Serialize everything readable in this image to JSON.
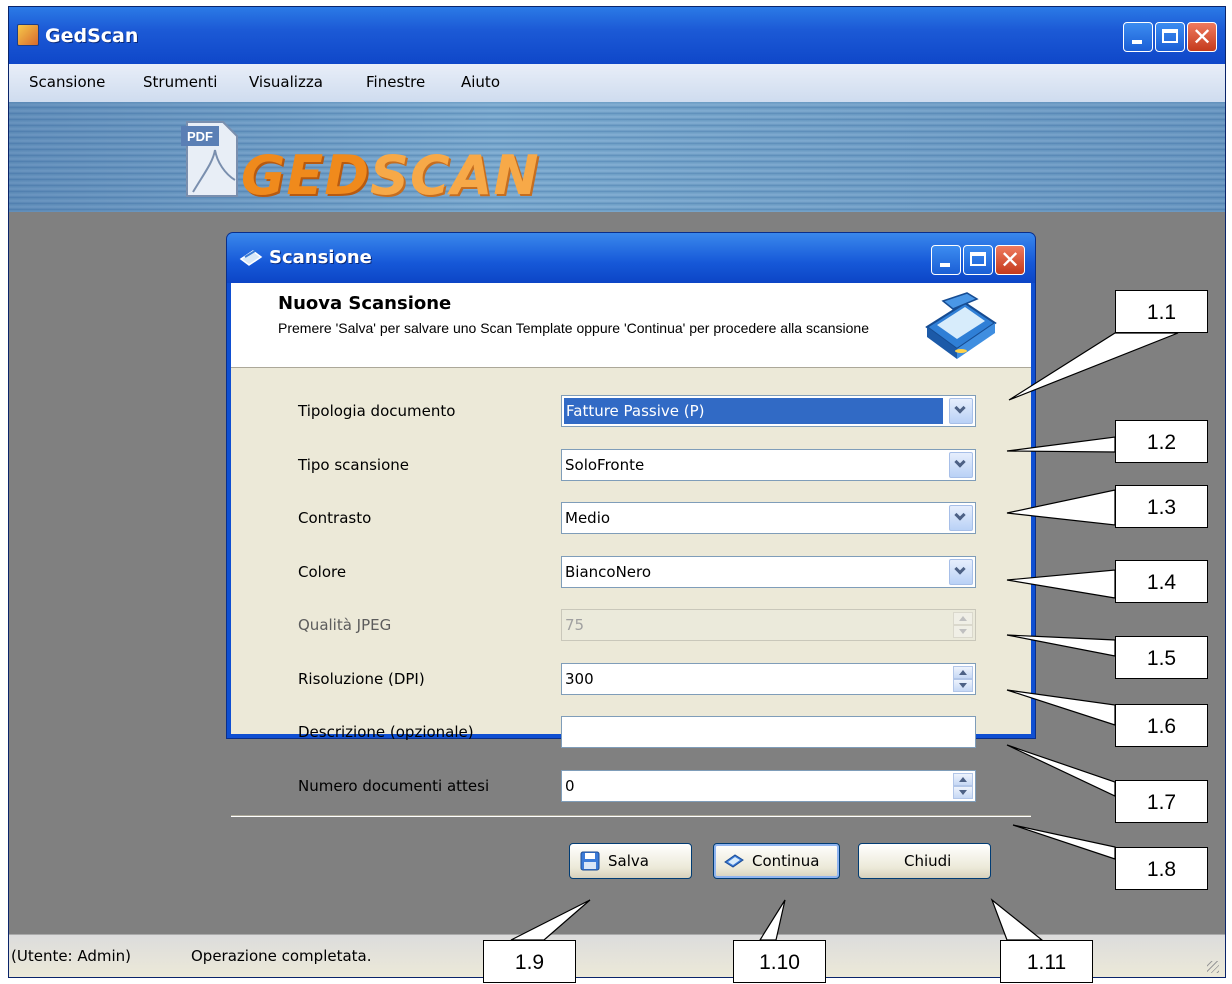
{
  "window": {
    "title": "GedScan"
  },
  "menu": [
    "Scansione",
    "Strumenti",
    "Visualizza",
    "Finestre",
    "Aiuto"
  ],
  "banner": {
    "pdf_tag": "PDF",
    "logo_part1": "GED",
    "logo_part2": "SCAN"
  },
  "dialog": {
    "title": "Scansione",
    "header_title": "Nuova Scansione",
    "header_desc": "Premere 'Salva' per salvare uno Scan Template oppure 'Continua' per procedere alla scansione",
    "fields": [
      {
        "label": "Tipologia documento",
        "value": "Fatture Passive (P)",
        "type": "dropdown",
        "selected": true
      },
      {
        "label": "Tipo scansione",
        "value": "SoloFronte",
        "type": "dropdown"
      },
      {
        "label": "Contrasto",
        "value": "Medio",
        "type": "dropdown"
      },
      {
        "label": "Colore",
        "value": "BiancoNero",
        "type": "dropdown"
      },
      {
        "label": "Qualità JPEG",
        "value": "75",
        "type": "spinner",
        "disabled": true
      },
      {
        "label": "Risoluzione (DPI)",
        "value": "300",
        "type": "spinner"
      },
      {
        "label": "Descrizione (opzionale)",
        "value": "",
        "type": "text"
      },
      {
        "label": "Numero documenti attesi",
        "value": "0",
        "type": "spinner"
      }
    ],
    "buttons": {
      "save": "Salva",
      "continue": "Continua",
      "close": "Chiudi"
    }
  },
  "status": {
    "user": "(Utente: Admin)",
    "message": "Operazione completata."
  },
  "callouts": [
    "1.1",
    "1.2",
    "1.3",
    "1.4",
    "1.5",
    "1.6",
    "1.7",
    "1.8",
    "1.9",
    "1.10",
    "1.11"
  ],
  "colors": {
    "xp_blue": "#0f4fd2",
    "selection": "#316ac5",
    "dialog_bg": "#ece9d8"
  }
}
